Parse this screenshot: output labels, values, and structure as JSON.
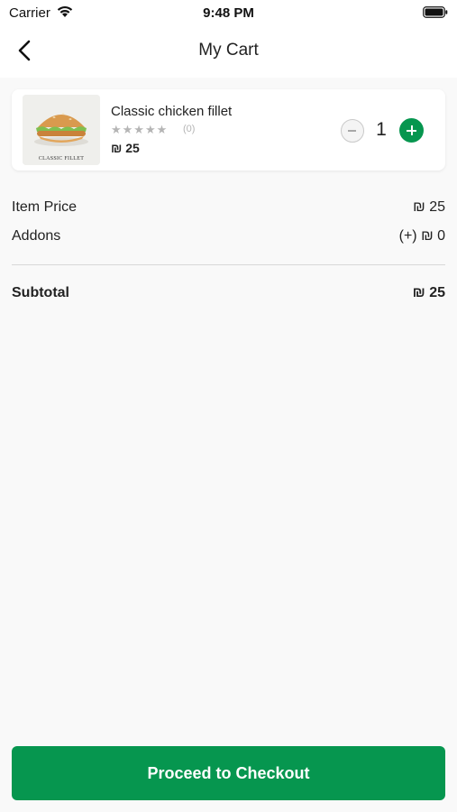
{
  "status_bar": {
    "carrier": "Carrier",
    "time": "9:48 PM",
    "icons": [
      "wifi-icon",
      "battery-icon"
    ]
  },
  "nav": {
    "title": "My Cart",
    "back_icon": "chevron-left-icon"
  },
  "cart": {
    "items": [
      {
        "name": "Classic chicken fillet",
        "image_caption": "CLASSIC FILLET",
        "stars": "★★★★★",
        "rating_count": "(0)",
        "rating": 0,
        "price": "₪ 25",
        "quantity": "1"
      }
    ]
  },
  "summary": {
    "item_price_label": "Item Price",
    "item_price_value": "₪ 25",
    "addons_label": "Addons",
    "addons_value": "(+) ₪ 0",
    "subtotal_label": "Subtotal",
    "subtotal_value": "₪ 25"
  },
  "checkout": {
    "label": "Proceed to Checkout"
  },
  "colors": {
    "accent": "#06964f",
    "background": "#f9f9f9",
    "star_inactive": "#b5b5b5"
  }
}
